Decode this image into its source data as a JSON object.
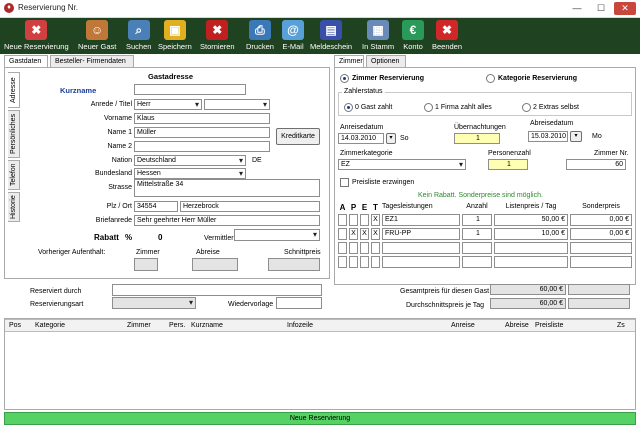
{
  "window": {
    "title": "Reservierung Nr.",
    "minimize": "—",
    "maximize": "☐",
    "close": "✕"
  },
  "toolbar": [
    {
      "label": "Neue Reservierung",
      "icon": "new-reservation-icon",
      "color": "#d04040",
      "glyph": "✖"
    },
    {
      "label": "Neuer Gast",
      "icon": "new-guest-icon",
      "color": "#c07838",
      "glyph": "☺"
    },
    {
      "label": "Suchen",
      "icon": "search-icon",
      "color": "#4a7fb8",
      "glyph": "⌕"
    },
    {
      "label": "Speichern",
      "icon": "save-icon",
      "color": "#e0b020",
      "glyph": "▣"
    },
    {
      "label": "Stornieren",
      "icon": "cancel-icon",
      "color": "#c02020",
      "glyph": "✖"
    },
    {
      "label": "Drucken",
      "icon": "printer-icon",
      "color": "#3a78b8",
      "glyph": "⎙"
    },
    {
      "label": "E-Mail",
      "icon": "email-icon",
      "color": "#5aa0d8",
      "glyph": "@"
    },
    {
      "label": "Meldeschein",
      "icon": "registration-form-icon",
      "color": "#3a50a8",
      "glyph": "▤"
    },
    {
      "label": "In Stamm",
      "icon": "master-data-icon",
      "color": "#6a8ab8",
      "glyph": "▦"
    },
    {
      "label": "Konto",
      "icon": "account-icon",
      "color": "#2a9a5a",
      "glyph": "€"
    },
    {
      "label": "Beenden",
      "icon": "exit-icon",
      "color": "#d02828",
      "glyph": "✖"
    }
  ],
  "left_tabs": [
    "Gastdaten",
    "Besteller- Firmendaten"
  ],
  "vertical_tabs": [
    "Adresse",
    "Persönliches",
    "Telefon",
    "Historie"
  ],
  "guest": {
    "section_title": "Gastadresse",
    "kurzname_label": "Kurzname",
    "anrede_label": "Anrede / Titel",
    "anrede_value": "Herr",
    "titel_value": "",
    "vorname_label": "Vorname",
    "vorname_value": "Klaus",
    "name1_label": "Name 1",
    "name1_value": "Müller",
    "name2_label": "Name 2",
    "name2_value": "",
    "nation_label": "Nation",
    "nation_value": "Deutschland",
    "nation_code": "DE",
    "bundesland_label": "Bundesland",
    "bundesland_value": "Hessen",
    "strasse_label": "Strasse",
    "strasse_value": "Mittelstraße 34",
    "plz_label": "Plz / Ort",
    "plz_value": "34554",
    "ort_value": "Herzebrock",
    "briefanrede_label": "Briefanrede",
    "briefanrede_value": "Sehr geehrter Herr Müller",
    "rabatt_label": "Rabatt",
    "rabatt_pct": "%",
    "rabatt_value": "0",
    "vermittler_label": "Vermittler",
    "kreditkarte_label": "Kreditkarte",
    "vorheriger_label": "Vorheriger Aufenthalt:",
    "zimmer_label": "Zimmer",
    "abreise_label": "Abreise",
    "schnittpreis_label": "Schnittpreis"
  },
  "lower_left": {
    "reserviert_label": "Reserviert  durch",
    "art_label": "Reservierungsart",
    "wiedervorlage_label": "Wiedervorlage"
  },
  "right_tabs": [
    "Zimmer",
    "Optionen"
  ],
  "reservation": {
    "zimmer_res_label": "Zimmer Reservierung",
    "kategorie_res_label": "Kategorie Reservierung",
    "zahlstatus_label": "Zahlerstatus",
    "zahl_options": [
      "0 Gast zahlt",
      "1 Firma zahlt alles",
      "2 Extras selbst"
    ],
    "anreise_label": "Anreisedatum",
    "anreise_value": "14.03.2010",
    "anreise_day": "So",
    "nacht_label": "Übernachtungen",
    "nacht_value": "1",
    "abreise_label": "Abreisedatum",
    "abreise_value": "15.03.2010",
    "abreise_day": "Mo",
    "kategorie_label": "Zimmerkategorie",
    "kategorie_value": "EZ",
    "personen_label": "Personenzahl",
    "personen_value": "1",
    "zimmernr_label": "Zimmer Nr.",
    "zimmernr_value": "60",
    "preisliste_label": "Preisliste erzwingen",
    "rabatt_info": "Kein Rabatt. Sonderpreise sind möglich."
  },
  "services": {
    "headers": {
      "a": "A",
      "p": "P",
      "e": "E",
      "t": "T",
      "tag": "Tagesleistungen",
      "anzahl": "Anzahl",
      "listen": "Listenpreis / Tag",
      "sonder": "Sonderpreis"
    },
    "rows": [
      {
        "a": "",
        "p": "",
        "e": "",
        "t": "X",
        "name": "EZ1",
        "anzahl": "1",
        "listen": "50,00 €",
        "sonder": "0,00 €"
      },
      {
        "a": "",
        "p": "X",
        "e": "X",
        "t": "X",
        "name": "FRÜ-PP",
        "anzahl": "1",
        "listen": "10,00 €",
        "sonder": "0,00 €"
      },
      {
        "a": "",
        "p": "",
        "e": "",
        "t": "",
        "name": "",
        "anzahl": "",
        "listen": "",
        "sonder": ""
      },
      {
        "a": "",
        "p": "",
        "e": "",
        "t": "",
        "name": "",
        "anzahl": "",
        "listen": "",
        "sonder": ""
      }
    ],
    "gesamt_label": "Gesamtpreis für diesen Gast",
    "gesamt_value": "60,00 €",
    "durchschnitt_label": "Durchschnittspreis je Tag",
    "durchschnitt_value": "60,00 €"
  },
  "table": {
    "columns": [
      "Pos",
      "Kategorie",
      "Zimmer",
      "Pers.",
      "Kurzname",
      "Infozeile",
      "Anreise",
      "Abreise",
      "Preisliste",
      "Zs"
    ]
  },
  "status": "Neue Reservierung"
}
